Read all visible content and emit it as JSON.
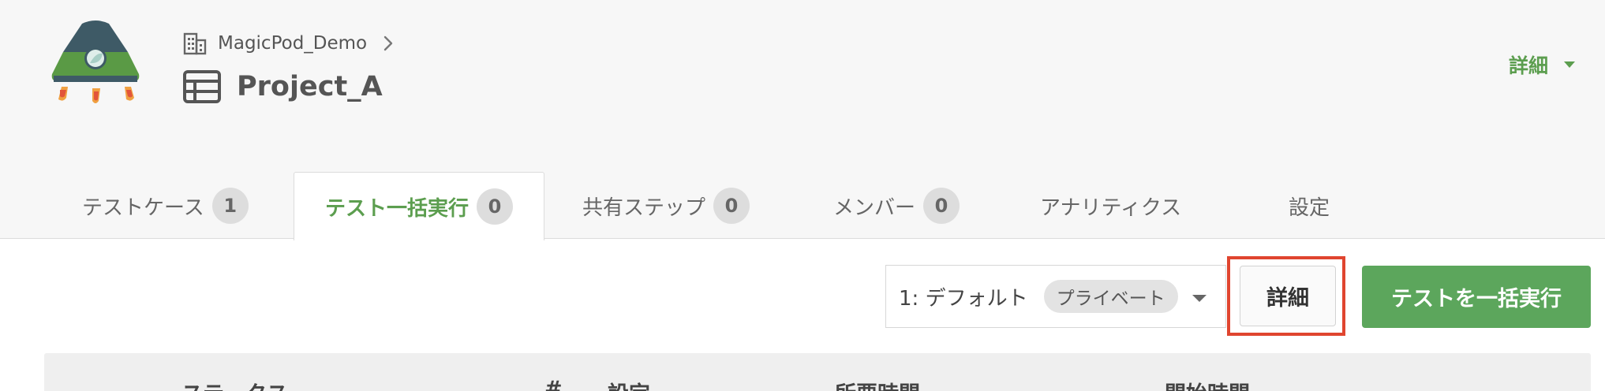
{
  "header": {
    "organization": "MagicPod_Demo",
    "project_name": "Project_A",
    "detail_menu_label": "詳細"
  },
  "tabs": [
    {
      "label": "テストケース",
      "count": "1",
      "active": false
    },
    {
      "label": "テスト一括実行",
      "count": "0",
      "active": true
    },
    {
      "label": "共有ステップ",
      "count": "0",
      "active": false
    },
    {
      "label": "メンバー",
      "count": "0",
      "active": false
    },
    {
      "label": "アナリティクス",
      "count": null,
      "active": false
    },
    {
      "label": "設定",
      "count": null,
      "active": false
    }
  ],
  "toolbar": {
    "config_value": "1: デフォルト",
    "config_visibility": "プライベート",
    "detail_button": "詳細",
    "run_button": "テストを一括実行"
  },
  "table": {
    "columns": [
      "ステータス",
      "#",
      "設定",
      "所要時間",
      "開始時間"
    ]
  },
  "colors": {
    "accent_green": "#5c9e4f",
    "run_button": "#5ca65c",
    "highlight_red": "#e0452f"
  },
  "icons": [
    "magicpod-logo",
    "building-icon",
    "chevron-right-icon",
    "table-icon",
    "caret-down-icon"
  ]
}
